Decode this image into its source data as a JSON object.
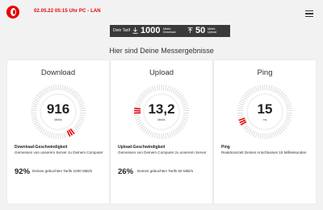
{
  "header": {
    "datetime": "02.05.22 05:15 Uhr PC - LAN"
  },
  "tariff": {
    "label": "Dein Tarif",
    "download_value": "1000",
    "download_unit": "Mbit/s",
    "download_caption": "Download",
    "upload_value": "50",
    "upload_unit": "Mbit/s",
    "upload_caption": "Upload"
  },
  "headline": "Hier sind Deine Messergebnisse",
  "cards": [
    {
      "title": "Download",
      "value": "916",
      "unit": "Mbit/s",
      "level": 0.92,
      "heading": "Download-Geschwindigkeit",
      "description": "Gemessen von unserem Server zu Deinem Computer",
      "percent": "92%",
      "percent_desc": "Deines gebuchten Tarifs 1000 Mbit/s"
    },
    {
      "title": "Upload",
      "value": "13,2",
      "unit": "Mbit/s",
      "level": 0.26,
      "heading": "Upload-Geschwindigkeit",
      "description": "Gemessen von Deinem Computer zu unserem Server",
      "percent": "26%",
      "percent_desc": "Deines gebuchten Tarifs 50 Mbit/s"
    },
    {
      "title": "Ping",
      "value": "15",
      "unit": "ms",
      "level": 0.18,
      "heading": "Ping",
      "description": "Reaktionszeit Deines Anschlusses 15 Millisekunden"
    }
  ],
  "colors": {
    "accent": "#e60000",
    "tick_inactive": "#cfcfcf",
    "dark_bar": "#3a3a3a"
  },
  "icons": {
    "logo": "vodafone-logo",
    "menu": "hamburger-menu-icon",
    "download": "download-arrow-icon",
    "upload": "upload-arrow-icon"
  }
}
